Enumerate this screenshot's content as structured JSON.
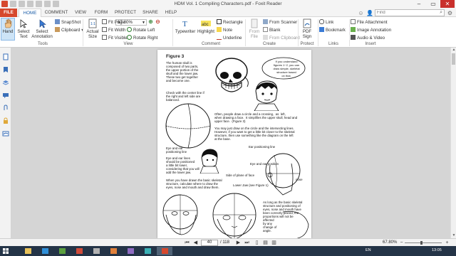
{
  "window": {
    "title": "HDM Vol. 1 Compiling Characters.pdf - Foxit Reader"
  },
  "ribbon_tabs": [
    "FILE",
    "HOME",
    "COMMENT",
    "VIEW",
    "FORM",
    "PROTECT",
    "SHARE",
    "HELP"
  ],
  "search": {
    "placeholder": "Find"
  },
  "ribbon": {
    "tools": {
      "hand": "Hand",
      "select_text": "Select\nText",
      "select_annotation": "Select\nAnnotation",
      "snapshot": "SnapShot",
      "clipboard": "Clipboard",
      "group_label": "Tools"
    },
    "view": {
      "actual_size": "Actual\nSize",
      "fit_page": "Fit Page",
      "fit_width": "Fit Width",
      "fit_visible": "Fit Visible",
      "zoom_value": "67.80%",
      "rotate_left": "Rotate Left",
      "rotate_right": "Rotate Right",
      "group_label": "View"
    },
    "comment": {
      "typewriter": "Typewriter",
      "highlight": "Highlight",
      "rectangle": "Rectangle",
      "note": "Note",
      "underline": "Underline",
      "group_label": "Comment"
    },
    "create": {
      "from_file": "From\nFile",
      "from_scanner": "From Scanner",
      "blank": "Blank",
      "from_clipboard": "From Clipboard",
      "group_label": "Create"
    },
    "protect": {
      "pdf_sign": "PDF\nSign",
      "group_label": "Protect"
    },
    "links": {
      "link": "Link",
      "bookmark": "Bookmark",
      "group_label": "Links"
    },
    "insert": {
      "file_attachment": "File Attachment",
      "image_annotation": "Image Annotation",
      "audio_video": "Audio & Video",
      "group_label": "Insert"
    }
  },
  "page": {
    "figure_title": "Figure 3",
    "text_skull": "The human skull is\ncomposed of two parts,\nthe upper portion of the\nskull and the lower jaw.\nThese two get together\nand become one.",
    "text_bubble": "If you understand\nfigures 1~2, you can\ndraw simple, skeletal\nstructure based\non that.",
    "text_check": "Check with the center line if\nthe right and left side are\nbalanced.",
    "text_circle": "Often, people draw a circle and a crossing,  as  left,\nwhen drawing a face.  It simplifies the upper skull, head and\nupper face.  (Figure 3)",
    "text_draw": "You may just draw on the circle and the intersecting lines.\nHowever, if you want to get a little bit closer to the skeletal\nstructure, then use something like the diagram on the left\nat the base.",
    "label_ear_pos": "Ear positioning line",
    "label_eye_ear": "Eye and ear\npositioning line",
    "label_eye_ear_pos": "Eye and ear position",
    "label_nose": "nose",
    "label_side": "Side of plane of face",
    "label_lower_jaw": "Lower Jaw (see Figure 1)",
    "text_eye_ear": "Eye and ear lines\nshould be positioned\na little bit lower,\nconsidering that you will\nadd the lower jaw.",
    "text_drawn": "When you have drawn the basic skeletal\nstructure, calculate where to draw the\neyes, nose and mouth and draw them.",
    "text_longas": "As long as the basic skeletal\nstructure and positioning of\neyes, nose and mouth have\nbeen correctly placed, the\nproportions will not be\naffected\nby any\nchange of\nangle."
  },
  "statusbar": {
    "page_current": "40",
    "page_total": "/ 118",
    "zoom": "67.80%"
  },
  "taskbar": {
    "lang": "EN",
    "time": "13:05"
  },
  "colors": {
    "accent": "#d6482d",
    "tab_active": "#1b5da8",
    "taskbar": "#243447"
  }
}
